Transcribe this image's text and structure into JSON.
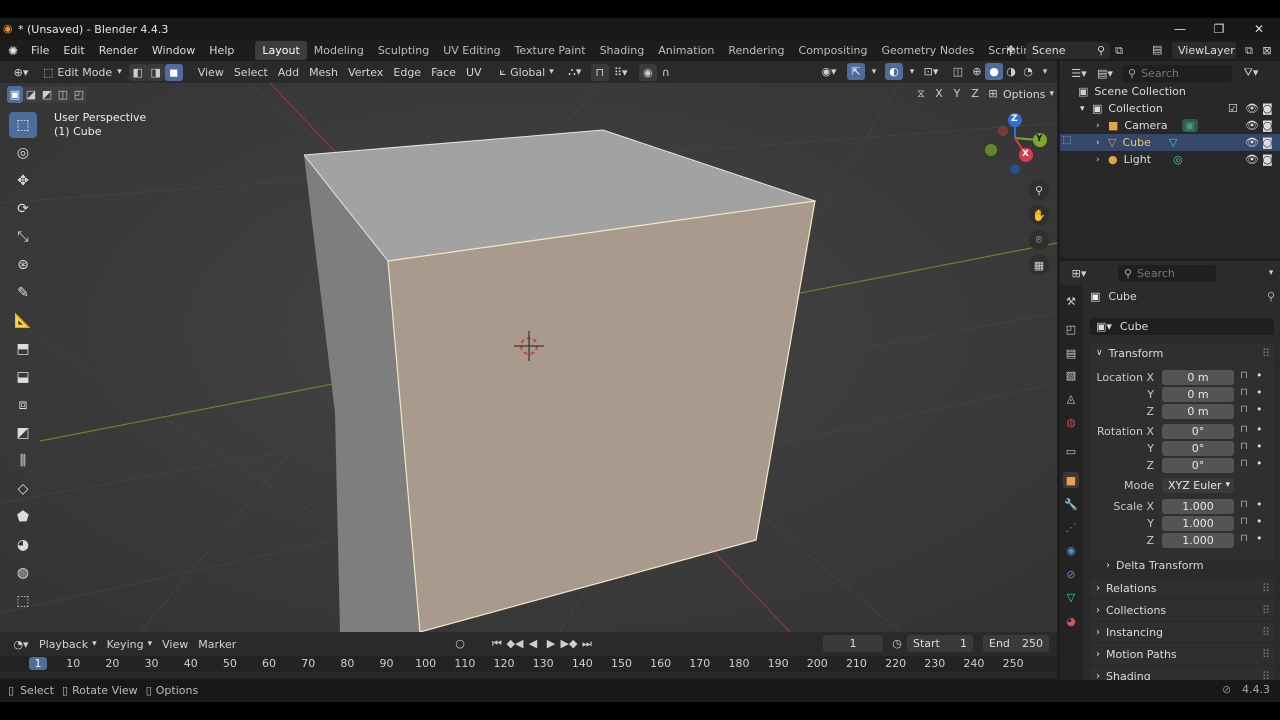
{
  "window": {
    "title": "* (Unsaved) - Blender 4.4.3",
    "minimize": "—",
    "maximize": "❐",
    "close": "✕"
  },
  "menus": [
    "File",
    "Edit",
    "Render",
    "Window",
    "Help"
  ],
  "workspaces": [
    "Layout",
    "Modeling",
    "Sculpting",
    "UV Editing",
    "Texture Paint",
    "Shading",
    "Animation",
    "Rendering",
    "Compositing",
    "Geometry Nodes",
    "Scripting"
  ],
  "add_workspace": "+",
  "scene": {
    "name": "Scene",
    "view_layer": "ViewLayer"
  },
  "header3d": {
    "mode": "Edit Mode",
    "menus": [
      "View",
      "Select",
      "Add",
      "Mesh",
      "Vertex",
      "Edge",
      "Face",
      "UV"
    ],
    "orientation": "Global",
    "options": "Options",
    "axes": [
      "X",
      "Y",
      "Z"
    ]
  },
  "viewport": {
    "perspective": "User Perspective",
    "object": "(1) Cube"
  },
  "gizmo": {
    "x": "X",
    "y": "Y",
    "z": "Z"
  },
  "outliner": {
    "search_placeholder": "Search",
    "root": "Scene Collection",
    "collection": "Collection",
    "items": [
      "Camera",
      "Cube",
      "Light"
    ]
  },
  "properties": {
    "search_placeholder": "Search",
    "object": "Cube",
    "object_name": "Cube",
    "transform_header": "Transform",
    "location_label": "Location X",
    "y_label": "Y",
    "z_label": "Z",
    "location": [
      "0 m",
      "0 m",
      "0 m"
    ],
    "rotation_label": "Rotation X",
    "rotation": [
      "0°",
      "0°",
      "0°"
    ],
    "mode_label": "Mode",
    "mode_value": "XYZ Euler",
    "scale_label": "Scale X",
    "scale": [
      "1.000",
      "1.000",
      "1.000"
    ],
    "delta_transform": "Delta Transform",
    "panels": [
      "Relations",
      "Collections",
      "Instancing",
      "Motion Paths",
      "Shading"
    ]
  },
  "timeline": {
    "menus": [
      "Playback",
      "Keying",
      "View",
      "Marker"
    ],
    "current_frame": "1",
    "start_label": "Start",
    "start": "1",
    "end_label": "End",
    "end": "250",
    "ticks": [
      "1",
      "10",
      "20",
      "30",
      "40",
      "50",
      "60",
      "70",
      "80",
      "90",
      "100",
      "110",
      "120",
      "130",
      "140",
      "150",
      "160",
      "170",
      "180",
      "190",
      "200",
      "210",
      "220",
      "230",
      "240",
      "250"
    ]
  },
  "status": {
    "select": "Select",
    "rotate": "Rotate View",
    "options": "Options",
    "version": "4.4.3"
  }
}
